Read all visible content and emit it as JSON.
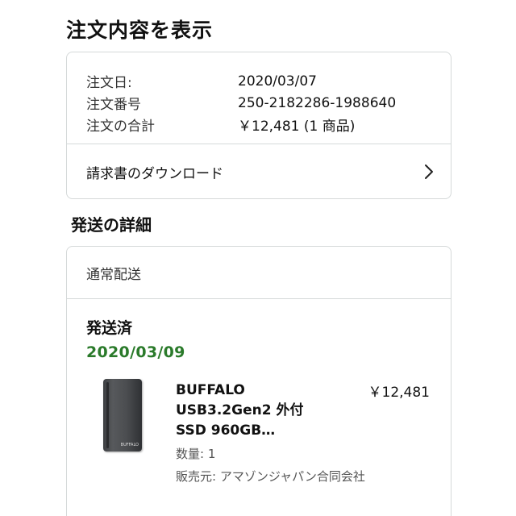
{
  "page_title": "注文内容を表示",
  "order_summary": {
    "rows": [
      {
        "label": "注文日:",
        "value": "2020/03/07"
      },
      {
        "label": "注文番号",
        "value": "250-2182286-1988640"
      },
      {
        "label": "注文の合計",
        "value": "￥12,481 (1 商品)"
      }
    ],
    "invoice_label": "請求書のダウンロード"
  },
  "shipping": {
    "section_title": "発送の詳細",
    "method": "通常配送",
    "status": "発送済",
    "date": "2020/03/09",
    "status_color": "#2a7a2a",
    "item": {
      "name_lines": [
        "BUFFALO",
        "USB3.2Gen2 外付",
        "SSD 960GB…"
      ],
      "price": "￥12,481",
      "quantity": "数量: 1",
      "seller": "販売元: アマゾンジャパン合同会社",
      "image_logo": "BUFFALO"
    }
  },
  "icons": {
    "invoice_chevron": "chevron-right-icon"
  }
}
